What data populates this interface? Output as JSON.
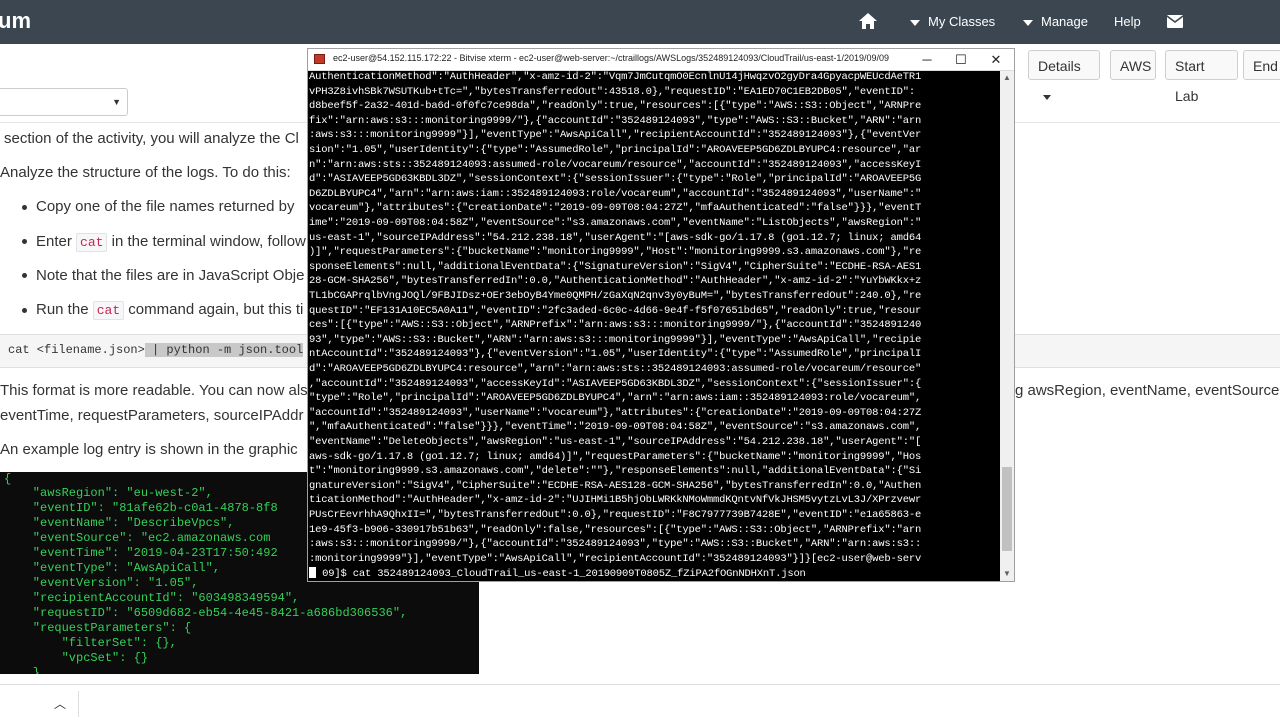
{
  "topnav": {
    "brand": "um",
    "my_classes": "My Classes",
    "manage": "Manage",
    "help": "Help"
  },
  "toolbar": {
    "details": "Details",
    "aws": "AWS",
    "start_lab": "Start Lab",
    "end": "End"
  },
  "instructions": {
    "p1": "section of the activity, you will analyze the Cl",
    "p2": "Analyze the structure of the logs. To do this:",
    "b1": "Copy one of the file names returned by",
    "b2_pre": "Enter",
    "b2_code": "cat",
    "b2_post": "in the terminal window, follow",
    "b3": "Note that the files are in JavaScript Obje",
    "b4_pre": "Run the",
    "b4_code": "cat",
    "b4_post": "command again, but this ti",
    "code_cmd": "cat <filename.json>",
    "code_pipe": " | python -m json.tool",
    "p3_left": "This format is more readable. You can now als",
    "p3_right": "g awsRegion, eventName, eventSource",
    "p4": "eventTime, requestParameters, sourceIPAddr",
    "p5": "An example log entry is shown in the graphic"
  },
  "json_example": [
    "{",
    "    \"awsRegion\": \"eu-west-2\",",
    "    \"eventID\": \"81afe62b-c0a1-4878-8f8",
    "    \"eventName\": \"DescribeVpcs\",",
    "    \"eventSource\": \"ec2.amazonaws.com",
    "    \"eventTime\": \"2019-04-23T17:50:492",
    "    \"eventType\": \"AwsApiCall\",",
    "    \"eventVersion\": \"1.05\",",
    "    \"recipientAccountId\": \"603498349594\",",
    "    \"requestID\": \"6509d682-eb54-4e45-8421-a686bd306536\",",
    "    \"requestParameters\": {",
    "        \"filterSet\": {},",
    "        \"vpcSet\": {}",
    "    },"
  ],
  "terminal": {
    "title": "ec2-user@54.152.115.172:22 - Bitvise xterm - ec2-user@web-server:~/ctraillogs/AWSLogs/352489124093/CloudTrail/us-east-1/2019/09/09",
    "lines": [
      "AuthenticationMethod\":\"AuthHeader\",\"x-amz-id-2\":\"Vqm7JmCutqmO0EcnlnU14jHwqzvO2gyDra4GpyacpWEUcdAeTR1",
      "vPH3Z8ivhSBk7WSUTKub+tTc=\",\"bytesTransferredOut\":43518.0},\"requestID\":\"EA1ED70C1EB2DB05\",\"eventID\":",
      "d8beef5f-2a32-401d-ba6d-0f0fc7ce98da\",\"readOnly\":true,\"resources\":[{\"type\":\"AWS::S3::Object\",\"ARNPre",
      "fix\":\"arn:aws:s3:::monitoring9999/\"},{\"accountId\":\"352489124093\",\"type\":\"AWS::S3::Bucket\",\"ARN\":\"arn",
      ":aws:s3:::monitoring9999\"}],\"eventType\":\"AwsApiCall\",\"recipientAccountId\":\"352489124093\"},{\"eventVer",
      "sion\":\"1.05\",\"userIdentity\":{\"type\":\"AssumedRole\",\"principalId\":\"AROAVEEP5GD6ZDLBYUPC4:resource\",\"ar",
      "n\":\"arn:aws:sts::352489124093:assumed-role/vocareum/resource\",\"accountId\":\"352489124093\",\"accessKeyI",
      "d\":\"ASIAVEEP5GD63KBDL3DZ\",\"sessionContext\":{\"sessionIssuer\":{\"type\":\"Role\",\"principalId\":\"AROAVEEP5G",
      "D6ZDLBYUPC4\",\"arn\":\"arn:aws:iam::352489124093:role/vocareum\",\"accountId\":\"352489124093\",\"userName\":\"",
      "vocareum\"},\"attributes\":{\"creationDate\":\"2019-09-09T08:04:27Z\",\"mfaAuthenticated\":\"false\"}}},\"eventT",
      "ime\":\"2019-09-09T08:04:58Z\",\"eventSource\":\"s3.amazonaws.com\",\"eventName\":\"ListObjects\",\"awsRegion\":\"",
      "us-east-1\",\"sourceIPAddress\":\"54.212.238.18\",\"userAgent\":\"[aws-sdk-go/1.17.8 (go1.12.7; linux; amd64",
      ")]\",\"requestParameters\":{\"bucketName\":\"monitoring9999\",\"Host\":\"monitoring9999.s3.amazonaws.com\"},\"re",
      "sponseElements\":null,\"additionalEventData\":{\"SignatureVersion\":\"SigV4\",\"CipherSuite\":\"ECDHE-RSA-AES1",
      "28-GCM-SHA256\",\"bytesTransferredIn\":0.0,\"AuthenticationMethod\":\"AuthHeader\",\"x-amz-id-2\":\"YuYbWKkx+z",
      "TL1bCGAPrqlbVngJOQl/9FBJIDsz+OEr3ebOyB4Yme0QMPH/zGaXqN2qnv3y0yBuM=\",\"bytesTransferredOut\":240.0},\"re",
      "questID\":\"EF131A10EC5A0A11\",\"eventID\":\"2fc3aded-6c0c-4d66-9e4f-f5f07651bd65\",\"readOnly\":true,\"resour",
      "ces\":[{\"type\":\"AWS::S3::Object\",\"ARNPrefix\":\"arn:aws:s3:::monitoring9999/\"},{\"accountId\":\"3524891240",
      "93\",\"type\":\"AWS::S3::Bucket\",\"ARN\":\"arn:aws:s3:::monitoring9999\"}],\"eventType\":\"AwsApiCall\",\"recipie",
      "ntAccountId\":\"352489124093\"},{\"eventVersion\":\"1.05\",\"userIdentity\":{\"type\":\"AssumedRole\",\"principalI",
      "d\":\"AROAVEEP5GD6ZDLBYUPC4:resource\",\"arn\":\"arn:aws:sts::352489124093:assumed-role/vocareum/resource\"",
      ",\"accountId\":\"352489124093\",\"accessKeyId\":\"ASIAVEEP5GD63KBDL3DZ\",\"sessionContext\":{\"sessionIssuer\":{",
      "\"type\":\"Role\",\"principalId\":\"AROAVEEP5GD6ZDLBYUPC4\",\"arn\":\"arn:aws:iam::352489124093:role/vocareum\",",
      "\"accountId\":\"352489124093\",\"userName\":\"vocareum\"},\"attributes\":{\"creationDate\":\"2019-09-09T08:04:27Z",
      "\",\"mfaAuthenticated\":\"false\"}}},\"eventTime\":\"2019-09-09T08:04:58Z\",\"eventSource\":\"s3.amazonaws.com\",",
      "\"eventName\":\"DeleteObjects\",\"awsRegion\":\"us-east-1\",\"sourceIPAddress\":\"54.212.238.18\",\"userAgent\":\"[",
      "aws-sdk-go/1.17.8 (go1.12.7; linux; amd64)]\",\"requestParameters\":{\"bucketName\":\"monitoring9999\",\"Hos",
      "t\":\"monitoring9999.s3.amazonaws.com\",\"delete\":\"\"},\"responseElements\":null,\"additionalEventData\":{\"Si",
      "gnatureVersion\":\"SigV4\",\"CipherSuite\":\"ECDHE-RSA-AES128-GCM-SHA256\",\"bytesTransferredIn\":0.0,\"Authen",
      "ticationMethod\":\"AuthHeader\",\"x-amz-id-2\":\"UJIHMi1B5hjObLWRKkNMoWmmdKQntvNfVkJHSM5vytzLvL3J/XPrzvewr",
      "PUsCrEevrhhA9QhxII=\",\"bytesTransferredOut\":0.0},\"requestID\":\"F8C7977739B7428E\",\"eventID\":\"e1a65863-e",
      "1e9-45f3-b906-330917b51b63\",\"readOnly\":false,\"resources\":[{\"type\":\"AWS::S3::Object\",\"ARNPrefix\":\"arn",
      ":aws:s3:::monitoring9999/\"},{\"accountId\":\"352489124093\",\"type\":\"AWS::S3::Bucket\",\"ARN\":\"arn:aws:s3::",
      ":monitoring9999\"}],\"eventType\":\"AwsApiCall\",\"recipientAccountId\":\"352489124093\"}]}[ec2-user@web-serv"
    ],
    "prompt": " 09]$ cat 352489124093_CloudTrail_us-east-1_20190909T0805Z_fZiPA2fOGnNDHXnT.json"
  }
}
